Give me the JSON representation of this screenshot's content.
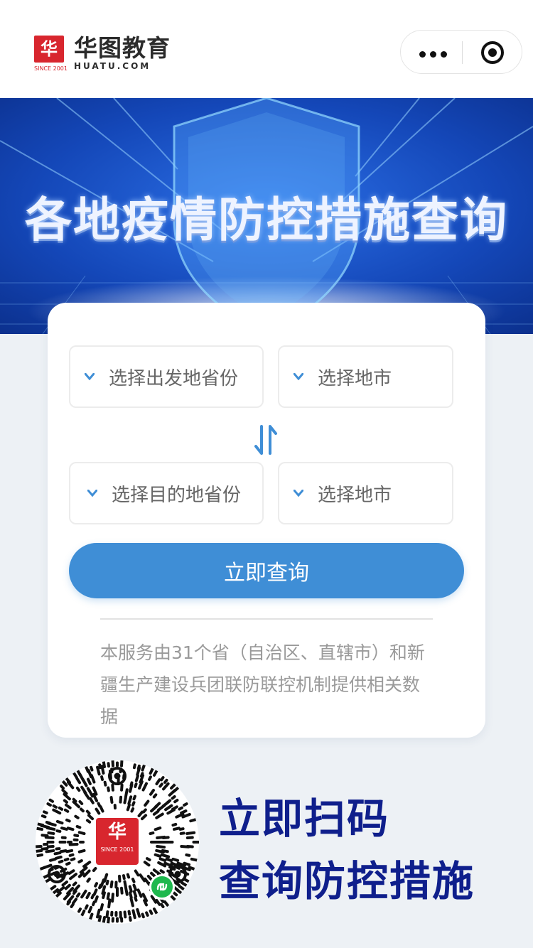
{
  "header": {
    "logo_mark": "华",
    "logo_since": "SINCE 2001",
    "logo_name": "华图教育",
    "logo_domain": "HUATU.COM",
    "capsule_icons": [
      "more-icon",
      "target-icon"
    ]
  },
  "banner": {
    "title": "各地疫情防控措施查询"
  },
  "form": {
    "depart_province": "选择出发地省份",
    "depart_city": "选择地市",
    "dest_province": "选择目的地省份",
    "dest_city": "选择地市",
    "submit_label": "立即查询",
    "note": "本服务由31个省（自治区、直辖市）和新疆生产建设兵团联防联控机制提供相关数据"
  },
  "promo": {
    "qr_logo_mark": "华",
    "qr_logo_since": "SINCE 2001",
    "line1": "立即扫码",
    "line2": "查询防控措施"
  },
  "colors": {
    "accent": "#3f8ed6",
    "brand_red": "#d8262e",
    "cta_text": "#0f1f8c",
    "background": "#edf1f5"
  }
}
